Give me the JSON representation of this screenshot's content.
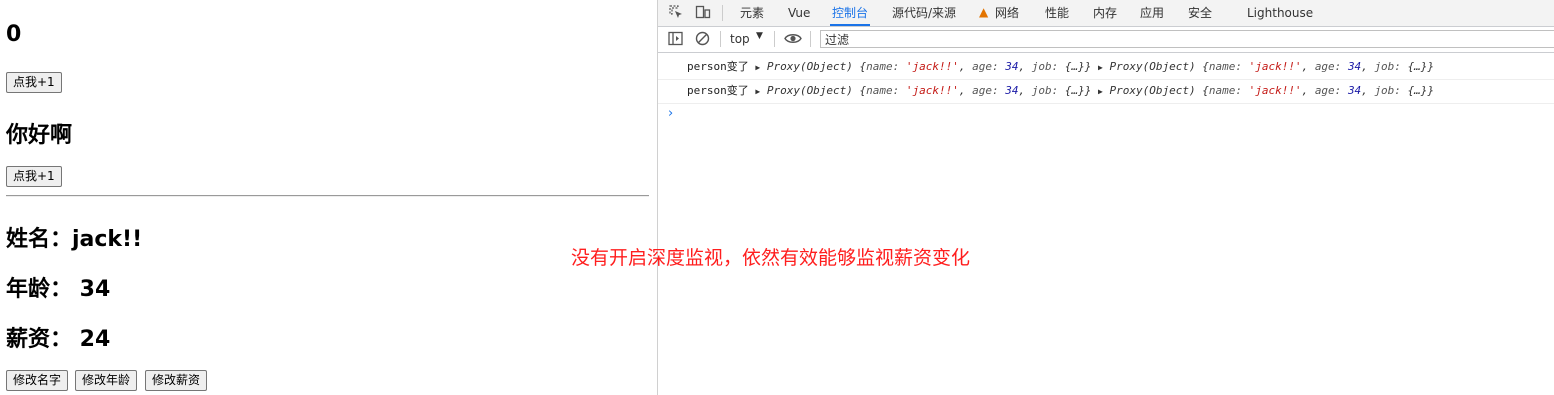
{
  "app": {
    "sum": "0",
    "btn_add1": "点我+1",
    "msg": "你好啊",
    "btn_add2": "点我+1",
    "name_line": "姓名：jack!!",
    "age_line": "年龄： 34",
    "salary_line": "薪资： 24",
    "btn_change_name": "修改名字",
    "btn_change_age": "修改年龄",
    "btn_change_salary": "修改薪资"
  },
  "devtools": {
    "tabs": [
      "元素",
      "Vue",
      "控制台",
      "源代码/来源",
      "网络",
      "性能",
      "内存",
      "应用",
      "安全",
      "Lighthouse"
    ],
    "active_tab": "控制台",
    "context": "top",
    "filter_placeholder": "过滤",
    "logs": [
      {
        "label": "person变了",
        "a": {
          "type": "Proxy(Object)",
          "name": "'jack!!'",
          "age": "34",
          "job": "{…}"
        },
        "b": {
          "type": "Proxy(Object)",
          "name": "'jack!!'",
          "age": "34",
          "job": "{…}"
        }
      },
      {
        "label": "person变了",
        "a": {
          "type": "Proxy(Object)",
          "name": "'jack!!'",
          "age": "34",
          "job": "{…}"
        },
        "b": {
          "type": "Proxy(Object)",
          "name": "'jack!!'",
          "age": "34",
          "job": "{…}"
        }
      }
    ],
    "prompt": "›"
  },
  "annotation": "没有开启深度监视，依然有效能够监视薪资变化",
  "colors": {
    "active_tab": "#1a73e8",
    "annotation": "#ff1e1e",
    "string": "#c41a16",
    "number": "#1a1aa6"
  }
}
